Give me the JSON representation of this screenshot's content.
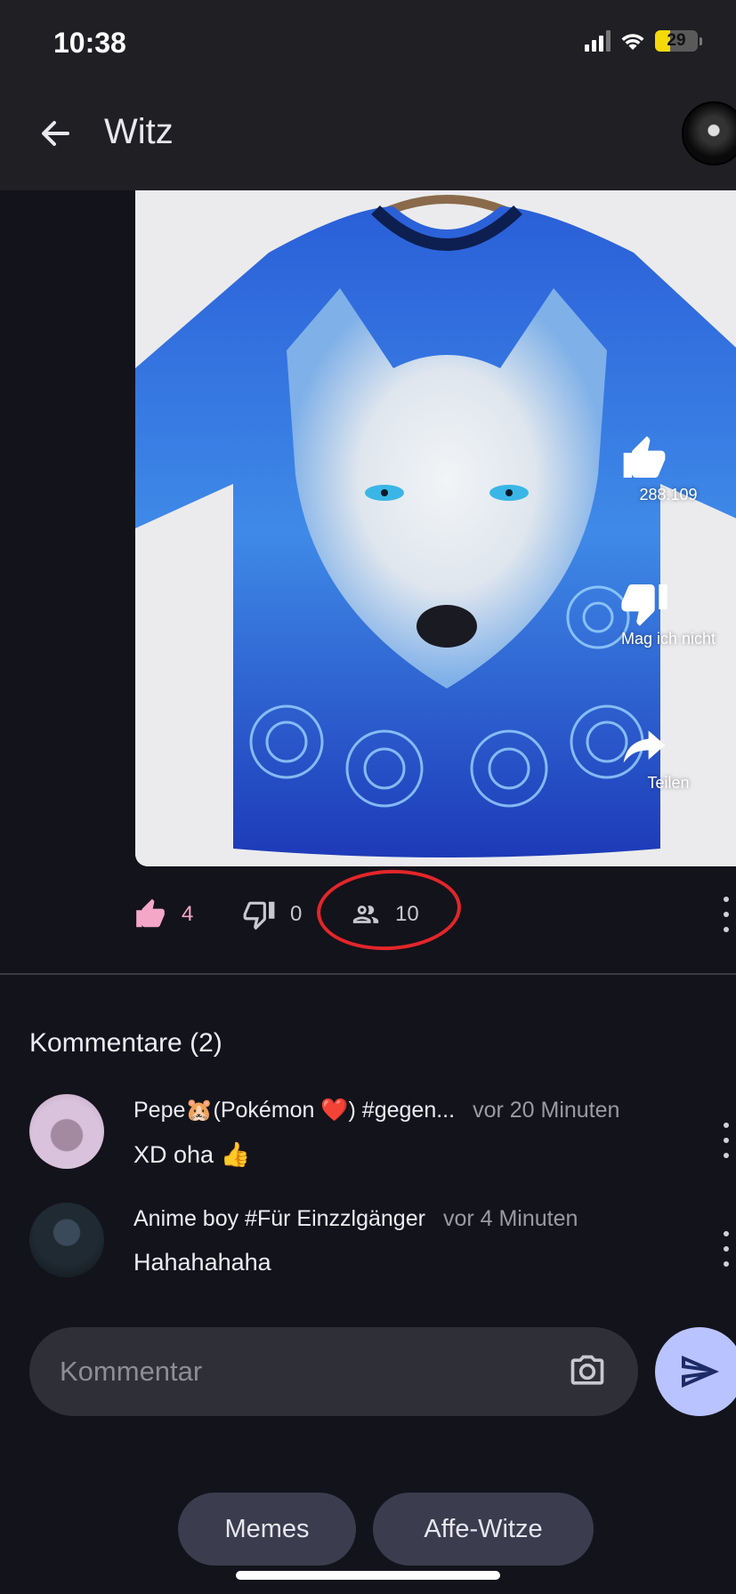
{
  "status_bar": {
    "time": "10:38",
    "battery": "29"
  },
  "header": {
    "title": "Witz",
    "back_icon": "arrow-left-icon"
  },
  "post": {
    "image_desc_icon": "wolf-tshirt-image",
    "overlay": {
      "likes": "288.109",
      "dislike_label": "Mag ich nicht",
      "share_label": "Teilen"
    }
  },
  "actions": {
    "like_count": "4",
    "dislike_count": "0",
    "viewers_count": "10",
    "like_color": "#f4a7c6",
    "highlight_color": "#e3262a"
  },
  "comments": {
    "heading": "Kommentare (2)",
    "items": [
      {
        "user": "Pepe🐹(Pokémon ❤️) #gegen...",
        "time": "vor 20 Minuten",
        "text": "XD oha 👍"
      },
      {
        "user": "Anime boy #Für Einzzlgänger",
        "time": "vor 4 Minuten",
        "text": "Hahahahaha"
      }
    ]
  },
  "composer": {
    "placeholder": "Kommentar"
  },
  "chips": {
    "memes": "Memes",
    "affe": "Affe-Witze"
  },
  "colors": {
    "accent": "#b9c3ff",
    "background": "#13131b",
    "header": "#1f1f24"
  }
}
